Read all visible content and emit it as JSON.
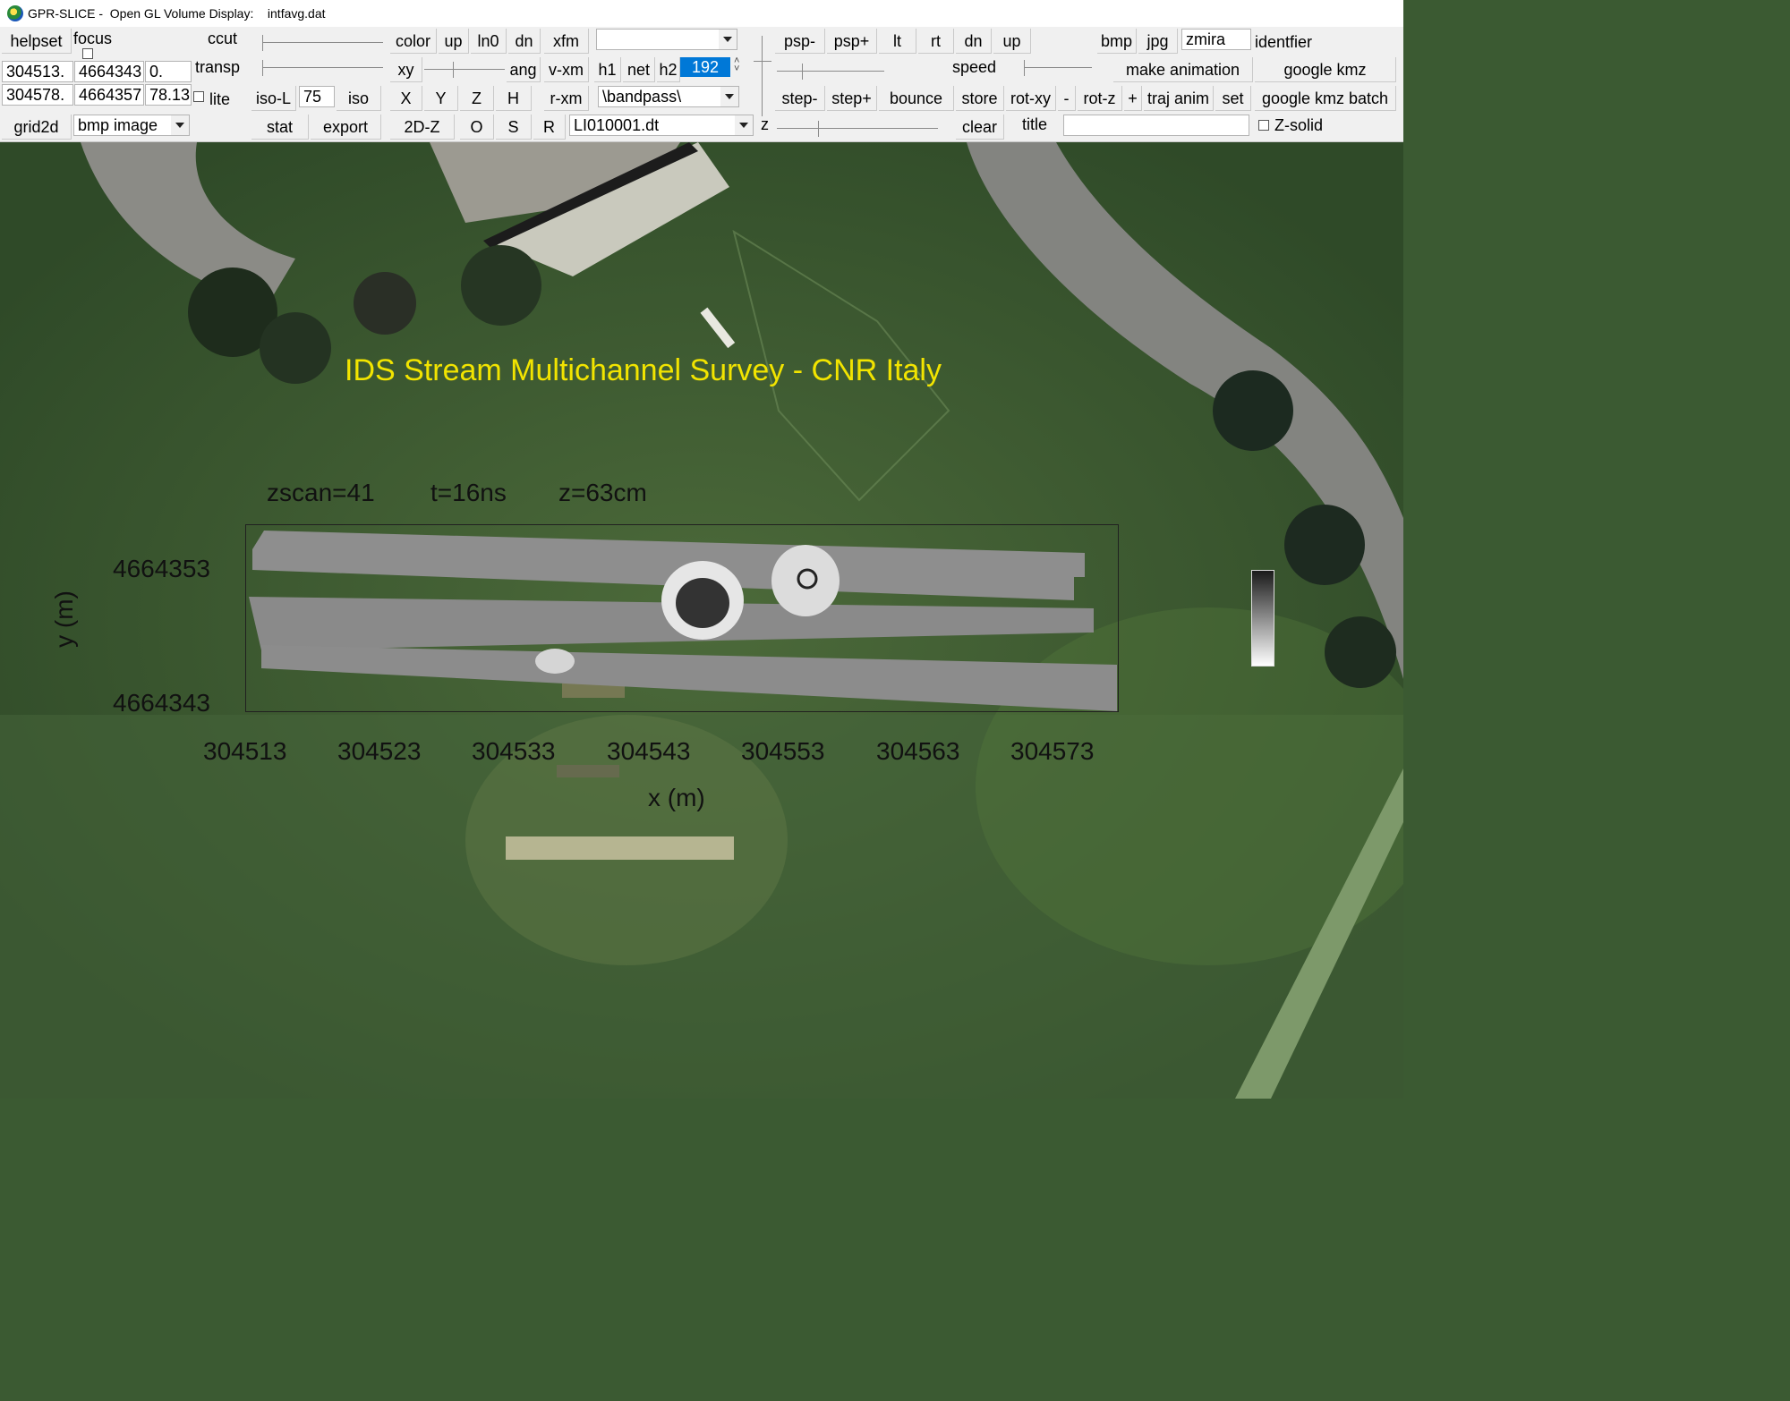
{
  "window": {
    "title": "GPR-SLICE -  Open GL Volume Display:    intfavg.dat"
  },
  "toolbar": {
    "helpset": "helpset",
    "focus": "focus",
    "ccut": "ccut",
    "transp": "transp",
    "lite": "lite",
    "grid2d": "grid2d",
    "coord_x1": "304513.",
    "coord_y1": "4664343",
    "coord_z1": "0.",
    "coord_x2": "304578.",
    "coord_y2": "4664357",
    "coord_z2": "78.13",
    "bmp_image": "bmp image",
    "iso_l": "iso-L",
    "iso_value": "75",
    "iso": "iso",
    "stat": "stat",
    "export": "export",
    "color": "color",
    "up1": "up",
    "ln0": "ln0",
    "dn1": "dn",
    "xfm": "xfm",
    "xy": "xy",
    "ang": "ang",
    "v_xm": "v-xm",
    "x": "X",
    "y": "Y",
    "z_btn": "Z",
    "h": "H",
    "r_xm": "r-xm",
    "two_d_z": "2D-Z",
    "o": "O",
    "s": "S",
    "r": "R",
    "h1": "h1",
    "net": "net",
    "h2": "h2",
    "h2_value": "192",
    "filter": "\\bandpass\\",
    "file": "LI010001.dt",
    "z_label": "z",
    "psp_minus": "psp-",
    "psp_plus": "psp+",
    "lt": "lt",
    "rt": "rt",
    "dn2": "dn",
    "up2": "up",
    "speed": "speed",
    "step_minus": "step-",
    "step_plus": "step+",
    "bounce": "bounce",
    "store": "store",
    "rot_xy": "rot-xy",
    "minus": "-",
    "rot_z": "rot-z",
    "plus": "+",
    "traj_anim": "traj anim",
    "set": "set",
    "clear": "clear",
    "title_label": "title",
    "bmp": "bmp",
    "jpg": "jpg",
    "identifier_value": "zmira",
    "identifier_label": "identfier",
    "make_animation": "make animation",
    "google_kmz": "google kmz",
    "google_kmz_batch": "google kmz batch",
    "z_solid": "Z-solid"
  },
  "display": {
    "survey_title": "IDS Stream Multichannel Survey - CNR Italy",
    "zscan": "zscan=41",
    "time": "t=16ns",
    "depth": "z=63cm",
    "y_axis_label": "y (m)",
    "x_axis_label": "x (m)",
    "y_ticks": [
      "4664353",
      "4664343"
    ],
    "x_ticks": [
      "304513",
      "304523",
      "304533",
      "304543",
      "304553",
      "304563",
      "304573"
    ]
  },
  "colors": {
    "title_yellow": "#f2e400",
    "selected_blue": "#0078d7"
  }
}
